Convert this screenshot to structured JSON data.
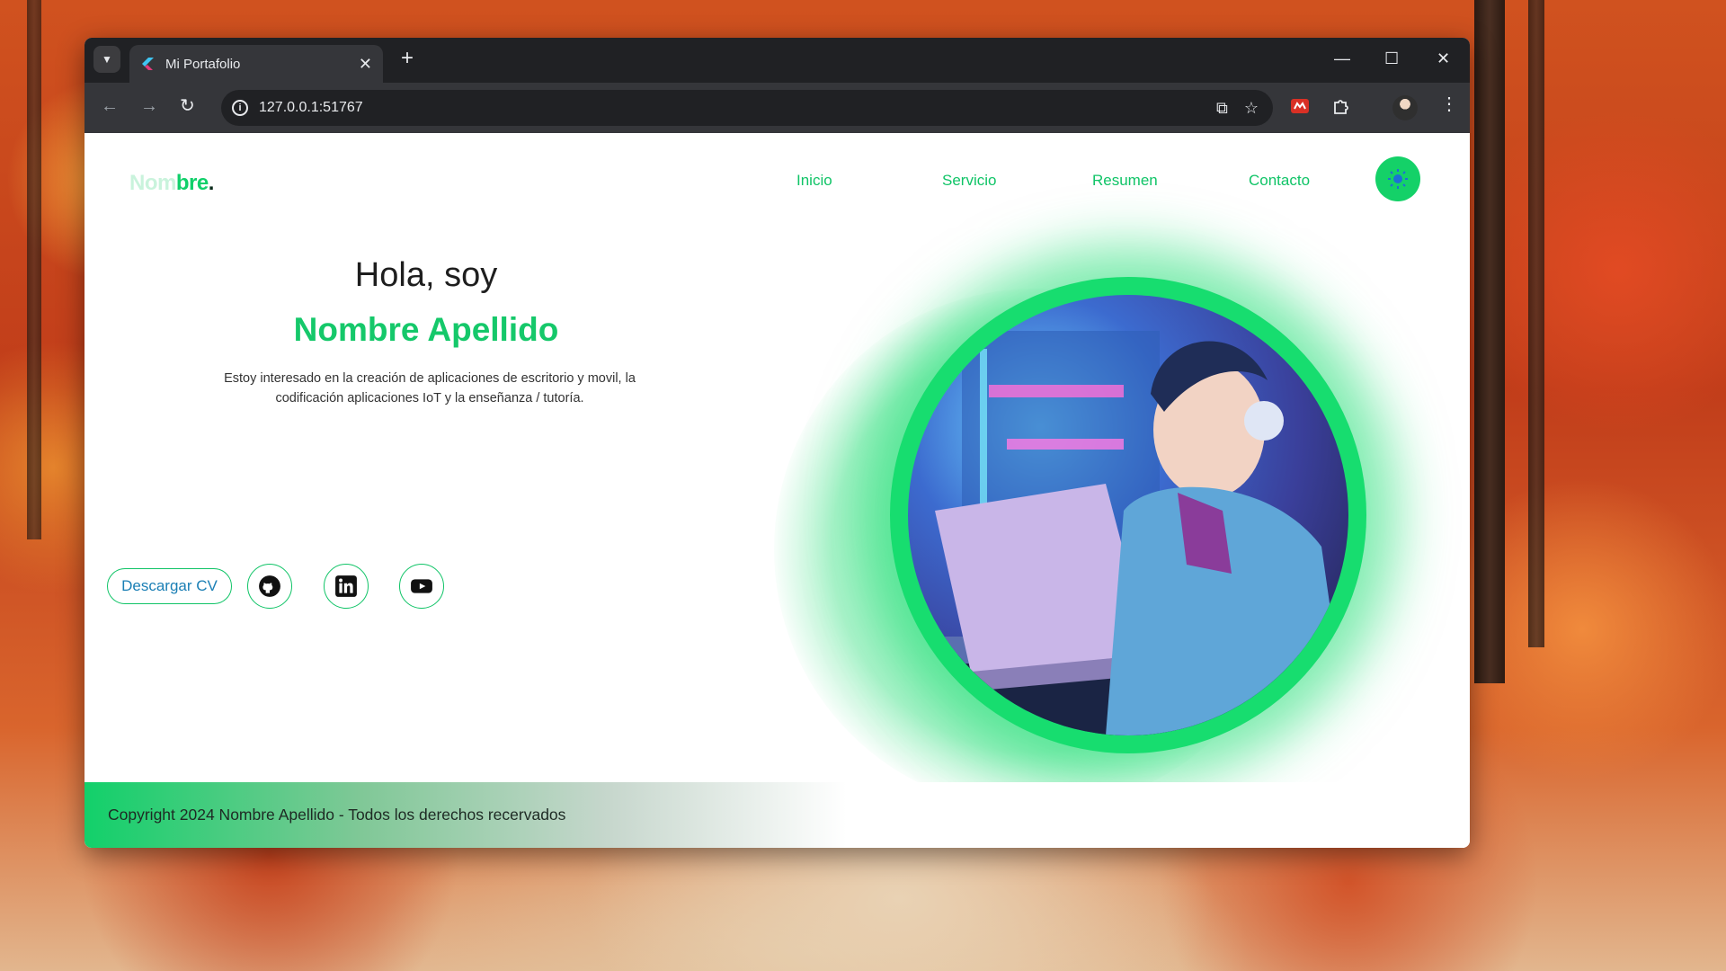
{
  "browser": {
    "tab_title": "Mi Portafolio",
    "url": "127.0.0.1:51767"
  },
  "site": {
    "logo_faded": "Nom",
    "logo_strong": "bre",
    "logo_dot": ".",
    "nav": [
      "Inicio",
      "Servicio",
      "Resumen",
      "Contacto"
    ],
    "greeting": "Hola, soy",
    "name": "Nombre Apellido",
    "bio_line1": "Estoy interesado en la creación de aplicaciones de escritorio y movil, la",
    "bio_line2": "codificación aplicaciones IoT y la enseñanza / tutoría.",
    "cv_button": "Descargar CV",
    "social_icons": [
      "github-icon",
      "linkedin-icon",
      "youtube-icon"
    ],
    "footer": "Copyright 2024 Nombre Apellido -  Todos los derechos recervados"
  },
  "colors": {
    "accent": "#10c467",
    "cv_text": "#1b7fb5"
  }
}
